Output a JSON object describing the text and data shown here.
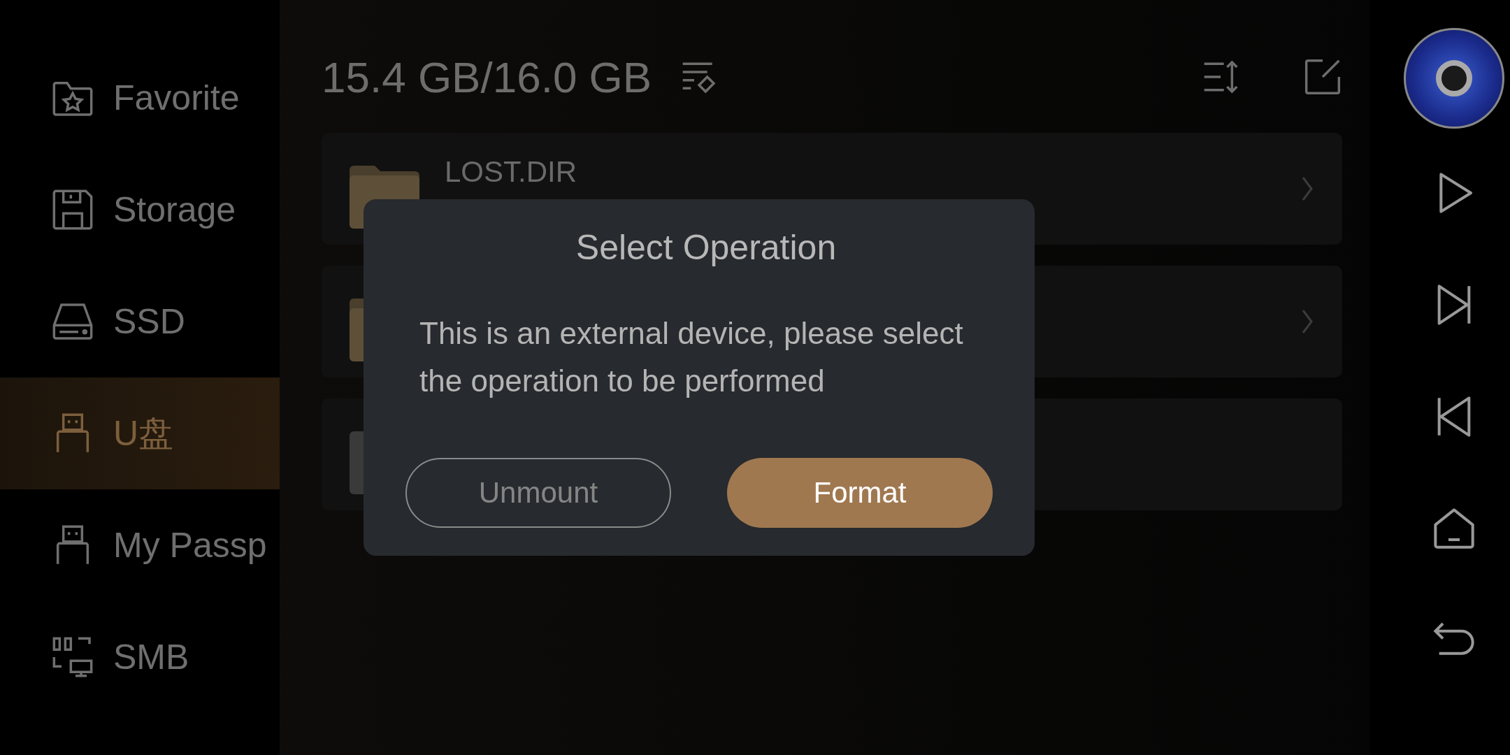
{
  "sidebar": {
    "items": [
      {
        "label": "Favorite",
        "selected": false
      },
      {
        "label": "Storage",
        "selected": false
      },
      {
        "label": "SSD",
        "selected": false
      },
      {
        "label": "U盘",
        "selected": true
      },
      {
        "label": "My Passp",
        "selected": false
      },
      {
        "label": "SMB",
        "selected": false
      }
    ]
  },
  "header": {
    "capacity": "15.4 GB/16.0 GB"
  },
  "files": [
    {
      "kind": "folder",
      "name": "LOST.DIR"
    },
    {
      "kind": "folder"
    },
    {
      "kind": "file"
    }
  ],
  "dialog": {
    "title": "Select Operation",
    "message": "This is an external device, please select the operation to be performed",
    "buttons": [
      {
        "label": "Unmount",
        "kind": "outline"
      },
      {
        "label": "Format",
        "kind": "primary"
      }
    ]
  }
}
